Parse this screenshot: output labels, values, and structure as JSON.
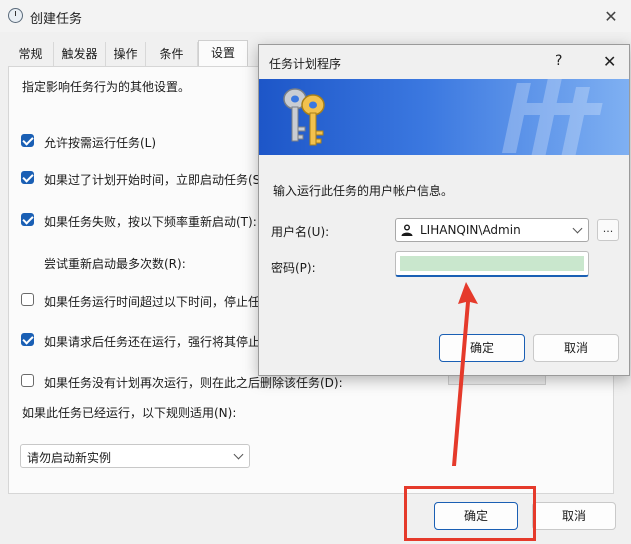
{
  "background_window": {
    "title": "创建任务",
    "tabs": [
      "常规",
      "触发器",
      "操作",
      "条件",
      "设置"
    ],
    "active_tab": "设置",
    "description": "指定影响任务行为的其他设置。",
    "options": [
      {
        "label": "允许按需运行任务(L)",
        "checked": true
      },
      {
        "label": "如果过了计划开始时间，立即启动任务(S",
        "checked": true
      },
      {
        "label": "如果任务失败，按以下频率重新启动(T):",
        "checked": true
      },
      {
        "label": "尝试重新启动最多次数(R):",
        "checked": null
      },
      {
        "label": "如果任务运行时间超过以下时间，停止任",
        "checked": false
      },
      {
        "label": "如果请求后任务还在运行，强行将其停止",
        "checked": true
      },
      {
        "label": "如果任务没有计划再次运行，则在此之后删除该任务(D):",
        "checked": false
      }
    ],
    "rule_label": "如果此任务已经运行，以下规则适用(N):",
    "rule_select_value": "请勿启动新实例",
    "ok_label": "确定",
    "cancel_label": "取消"
  },
  "dialog": {
    "title": "任务计划程序",
    "help_label": "?",
    "close_label": "✕",
    "instruction": "输入运行此任务的用户帐户信息。",
    "username_label": "用户名(U):",
    "username_value": "LIHANQIN\\Admin",
    "browse_label": "...",
    "password_label": "密码(P):",
    "ok_label": "确定",
    "cancel_label": "取消"
  },
  "colors": {
    "accent": "#1a5fb4",
    "highlight_red": "#e53a2b",
    "password_fill": "#c9e7cd",
    "banner_blue": "#1d56c8"
  },
  "icons": [
    "clock-icon",
    "keys-icon",
    "user-icon",
    "chevron-down-icon",
    "close-icon",
    "help-icon"
  ]
}
